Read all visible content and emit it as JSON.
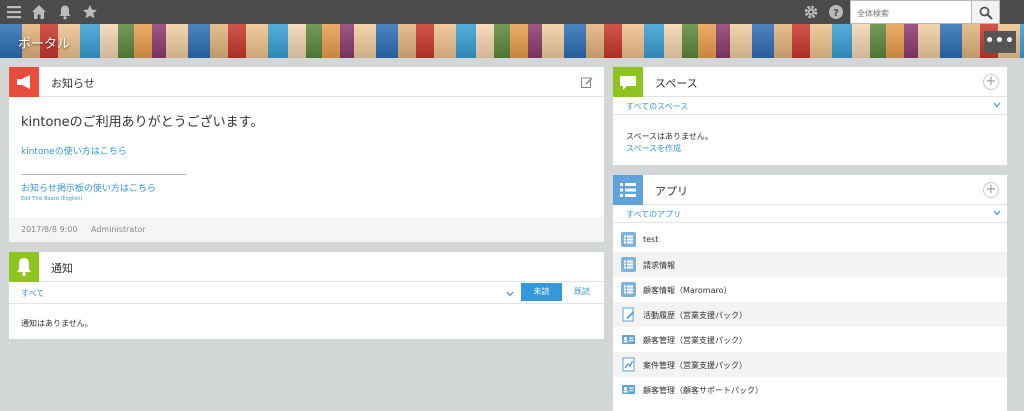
{
  "search": {
    "placeholder": "全体検索"
  },
  "banner": {
    "title": "ポータル",
    "more": "•••"
  },
  "notice": {
    "title": "お知らせ",
    "headline": "kintoneのご利用ありがとうございます。",
    "link1": "kintoneの使い方はこちら",
    "link2": "お知らせ掲示板の使い方はこちら",
    "link3": "Edit This Board (English)",
    "date": "2017/8/8 9:00",
    "author": "Administrator"
  },
  "notify": {
    "title": "通知",
    "filter": "すべて",
    "unread": "未読",
    "read": "既読",
    "empty": "通知はありません。"
  },
  "space": {
    "title": "スペース",
    "filter": "すべてのスペース",
    "empty": "スペースはありません。",
    "create": "スペースを作成"
  },
  "apps": {
    "title": "アプリ",
    "filter": "すべてのアプリ",
    "items": [
      {
        "name": "test",
        "icon": "list-icon"
      },
      {
        "name": "請求情報",
        "icon": "list-icon"
      },
      {
        "name": "顧客情報（Maromaro）",
        "icon": "list-icon"
      },
      {
        "name": "活動履歴（営業支援パック）",
        "icon": "document-edit-icon"
      },
      {
        "name": "顧客管理（営業支援パック）",
        "icon": "id-card-icon"
      },
      {
        "name": "案件管理（営業支援パック）",
        "icon": "document-chart-icon"
      },
      {
        "name": "顧客管理（顧客サポートパック）",
        "icon": "id-card-icon"
      }
    ]
  },
  "colors": {
    "accent": "#3498db",
    "topbar": "#4b4b4b",
    "notice_icon": "#e74c3c",
    "notify_icon": "#8fc31f",
    "space_icon": "#8fc31f",
    "apps_icon": "#5fa3d8"
  }
}
